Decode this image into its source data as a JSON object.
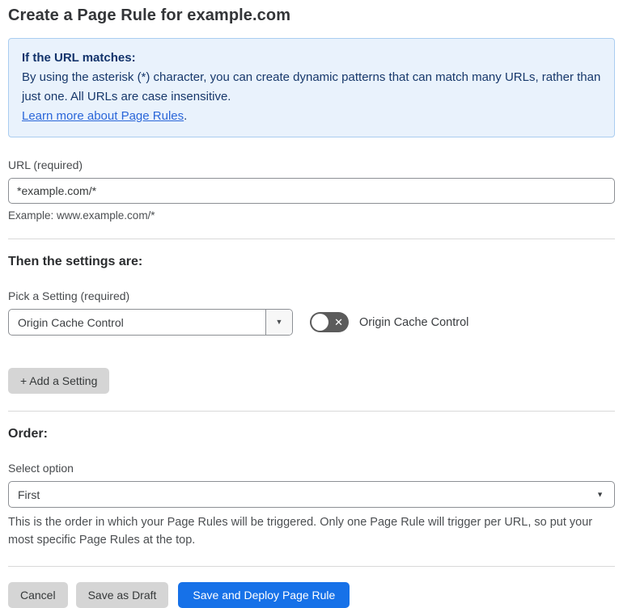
{
  "page": {
    "title": "Create a Page Rule for example.com"
  },
  "info_box": {
    "heading": "If the URL matches:",
    "body": "By using the asterisk (*) character, you can create dynamic patterns that can match many URLs, rather than just one. All URLs are case insensitive.",
    "link_label": "Learn more about Page Rules",
    "link_suffix": "."
  },
  "url_field": {
    "label": "URL (required)",
    "value": "*example.com/*",
    "example": "Example: www.example.com/*"
  },
  "settings_section": {
    "heading": "Then the settings are:",
    "picker_label": "Pick a Setting (required)",
    "selected_setting": "Origin Cache Control",
    "toggle_state": "off",
    "toggle_label": "Origin Cache Control",
    "add_button_label": "+ Add a Setting"
  },
  "order_section": {
    "heading": "Order:",
    "label": "Select option",
    "selected_option": "First",
    "help": "This is the order in which your Page Rules will be triggered. Only one Page Rule will trigger per URL, so put your most specific Page Rules at the top."
  },
  "footer": {
    "cancel_label": "Cancel",
    "save_draft_label": "Save as Draft",
    "save_deploy_label": "Save and Deploy Page Rule"
  },
  "icons": {
    "dropdown_arrow": "▼",
    "toggle_x": "✕"
  },
  "colors": {
    "info_box_bg": "#e9f2fc",
    "info_box_border": "#aacdf0",
    "info_text": "#17386b",
    "link_blue": "#2a66d9",
    "primary_button_bg": "#1671e8",
    "secondary_button_bg": "#d5d5d5",
    "toggle_off_bg": "#5b5b5b",
    "divider": "#d9d9d9"
  }
}
